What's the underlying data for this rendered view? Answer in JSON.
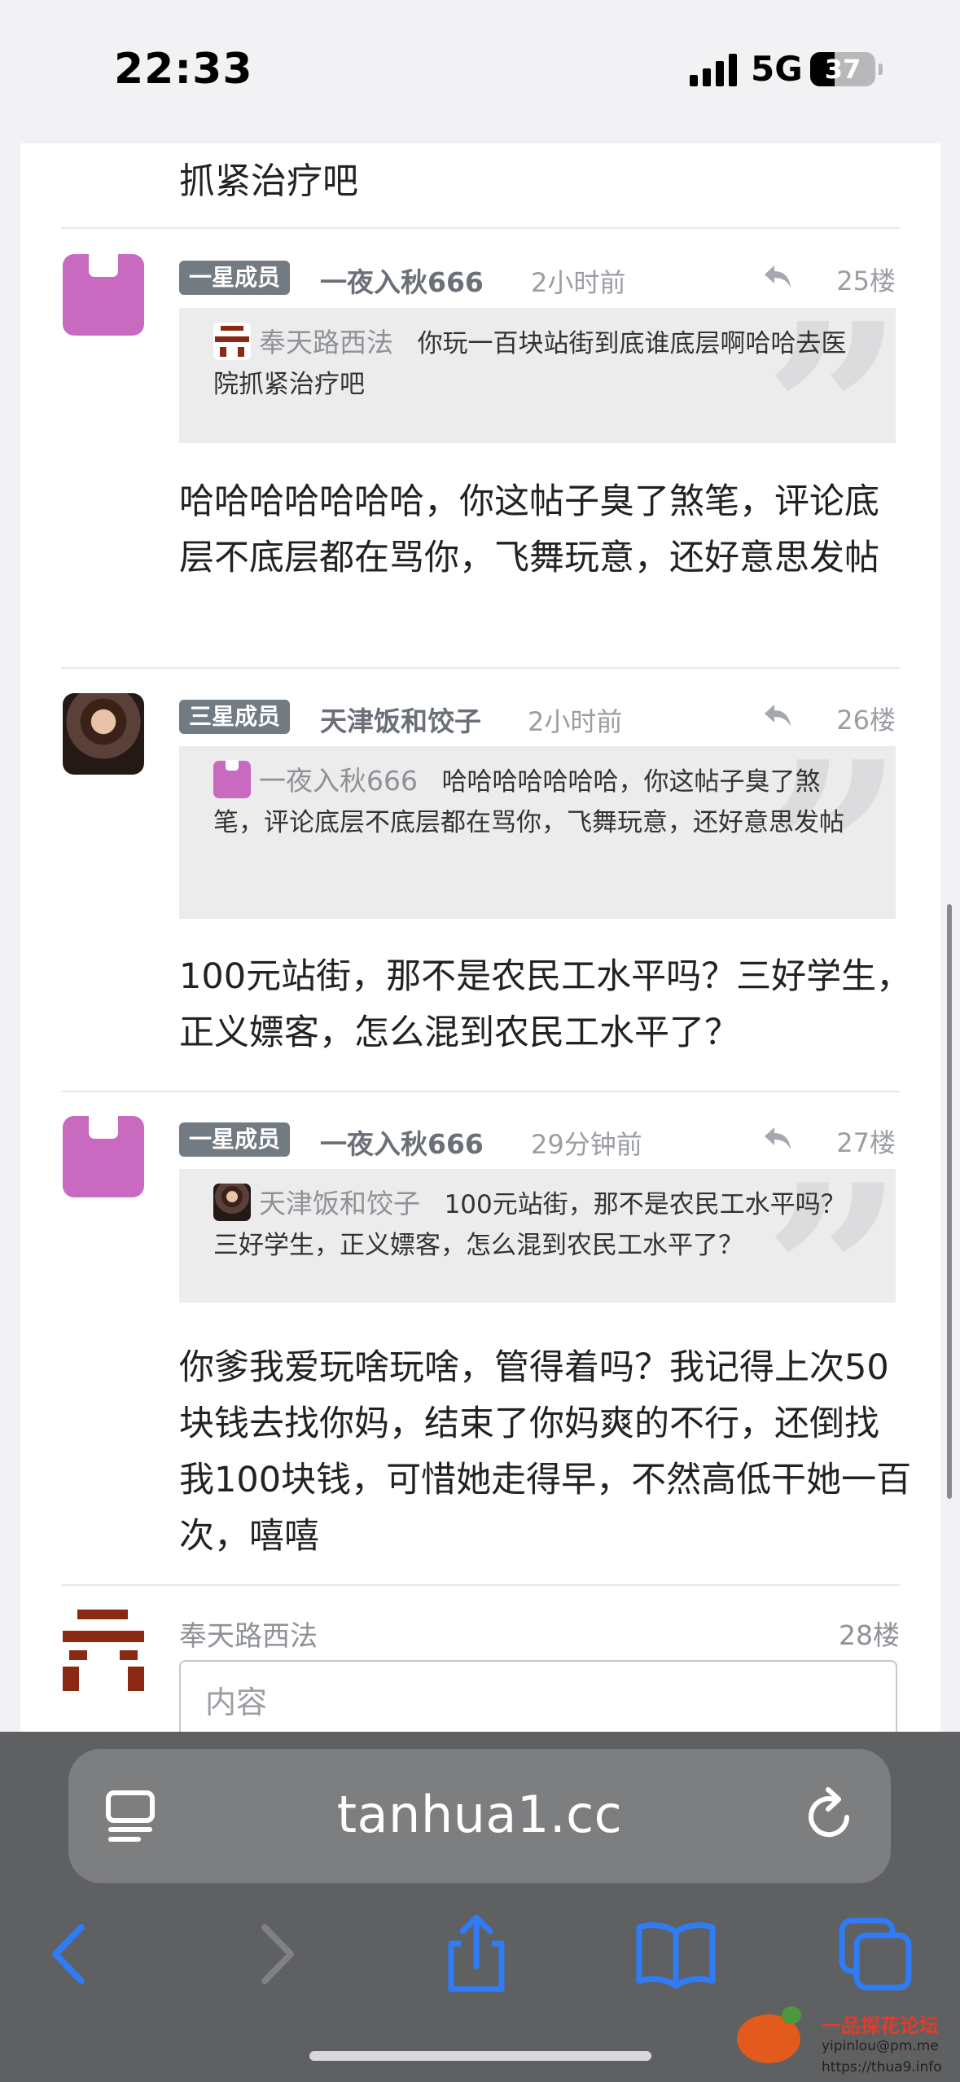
{
  "status": {
    "time": "22:33",
    "network": "5G",
    "battery": "37",
    "battery_level": 0.37
  },
  "top_snippet": "抓紧治疗吧",
  "posts": [
    {
      "badge": "一星成员",
      "username": "一夜入秋666",
      "time": "2小时前",
      "floor": "25楼",
      "quote_user": "奉天路西法",
      "quote_text": "你玩一百块站街到底谁底层啊哈哈去医院抓紧治疗吧",
      "body": "哈哈哈哈哈哈哈，你这帖子臭了煞笔，评论底层不底层都在骂你，飞舞玩意，还好意思发帖"
    },
    {
      "badge": "三星成员",
      "username": "天津饭和饺子",
      "time": "2小时前",
      "floor": "26楼",
      "quote_user": "一夜入秋666",
      "quote_text": "哈哈哈哈哈哈哈，你这帖子臭了煞笔，评论底层不底层都在骂你，飞舞玩意，还好意思发帖",
      "body": "100元站街，那不是农民工水平吗？三好学生，正义嫖客，怎么混到农民工水平了？"
    },
    {
      "badge": "一星成员",
      "username": "一夜入秋666",
      "time": "29分钟前",
      "floor": "27楼",
      "quote_user": "天津饭和饺子",
      "quote_text": "100元站街，那不是农民工水平吗？三好学生，正义嫖客，怎么混到农民工水平了？",
      "body": "你爹我爱玩啥玩啥，管得着吗？我记得上次50块钱去找你妈，结束了你妈爽的不行，还倒找我100块钱，可惜她走得早，不然高低干她一百次，嘻嘻"
    }
  ],
  "composer": {
    "username": "奉天路西法",
    "floor": "28楼",
    "placeholder": "内容"
  },
  "browser": {
    "url": "tanhua1.cc"
  },
  "watermark": {
    "name": "一品探花论坛",
    "email": "yipinlou@pm.me",
    "site": "https://thua9.info"
  },
  "colors": {
    "badge": "#727a82",
    "accent": "#2f7cf6",
    "avatar_purple": "#c86ac0",
    "avatar_glyph": "#8a2a14"
  }
}
